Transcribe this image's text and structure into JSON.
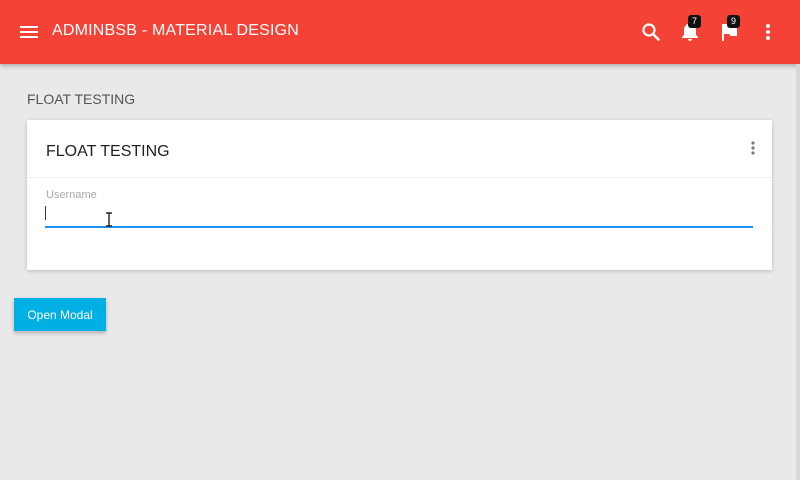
{
  "navbar": {
    "brand": "ADMINBSB - MATERIAL DESIGN",
    "menu_icon": "hamburger-icon",
    "search_icon": "search-icon",
    "notifications": {
      "icon": "bell-icon",
      "count": "7"
    },
    "tasks": {
      "icon": "flag-icon",
      "count": "9"
    },
    "more_icon": "more-vert-icon",
    "color": "#f44336"
  },
  "page": {
    "heading": "FLOAT TESTING"
  },
  "card": {
    "title": "FLOAT TESTING",
    "menu_icon": "more-vert-icon",
    "field": {
      "label": "Username",
      "value": "",
      "focus_color": "#1f91f3"
    }
  },
  "actions": {
    "open_modal_label": "Open Modal",
    "button_color": "#00b0e4"
  }
}
